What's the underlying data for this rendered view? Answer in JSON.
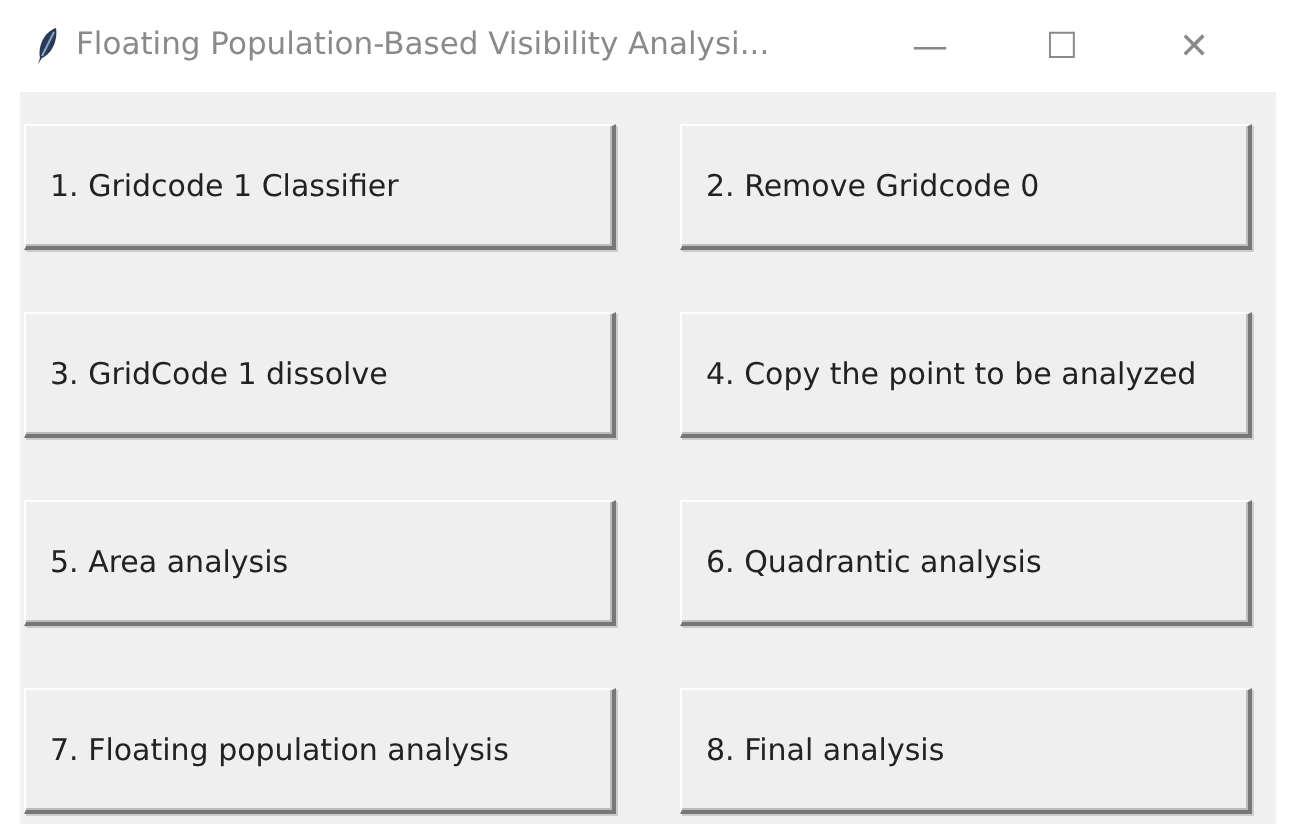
{
  "window": {
    "title": "Floating Population-Based Visibility Analysi...",
    "controls": [
      "—",
      "☐",
      "✕"
    ]
  },
  "buttons": [
    "1. Gridcode 1 Classifier",
    "2. Remove Gridcode 0",
    "3. GridCode 1 dissolve",
    "4. Copy the point to be analyzed",
    "5. Area analysis",
    "6. Quadrantic analysis",
    "7. Floating population analysis",
    "8. Final analysis"
  ]
}
